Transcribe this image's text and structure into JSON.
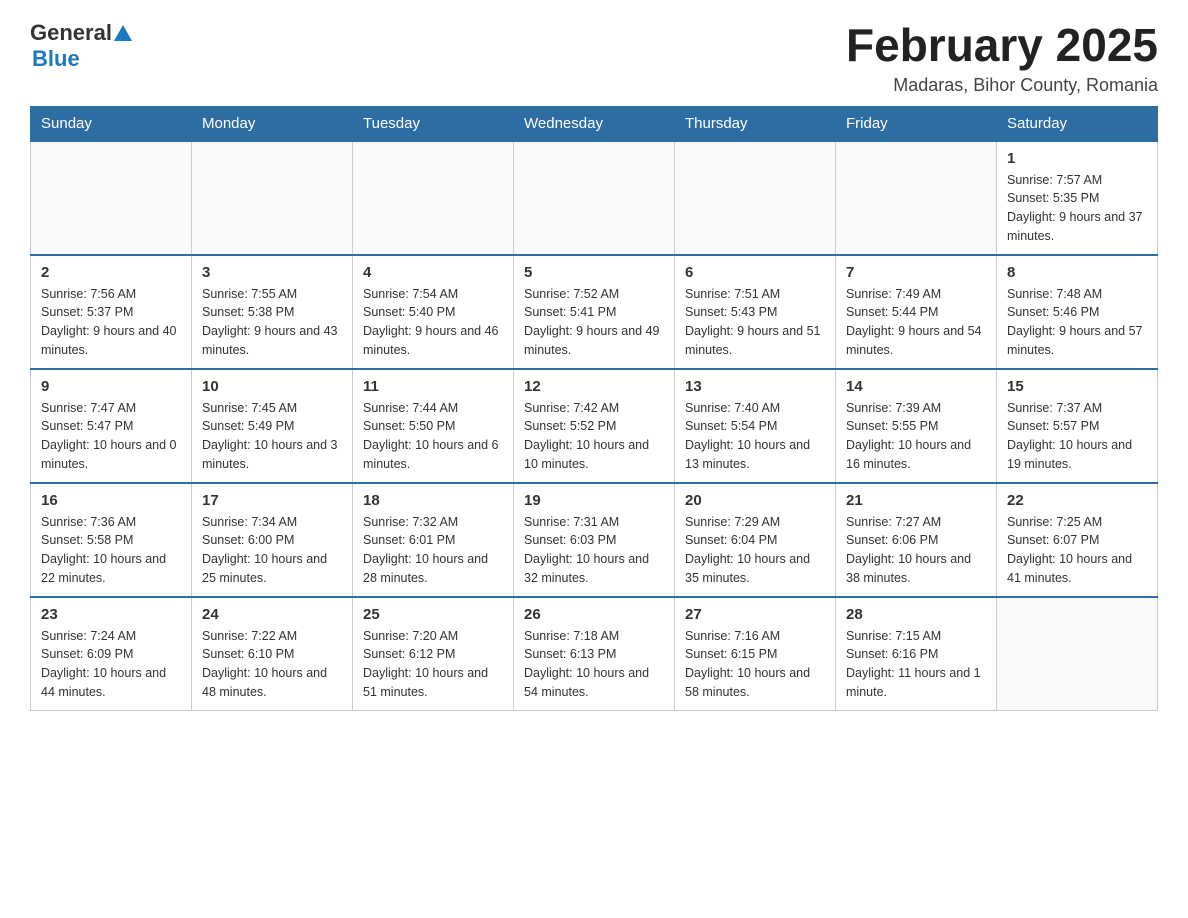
{
  "header": {
    "logo_general": "General",
    "logo_blue": "Blue",
    "title": "February 2025",
    "location": "Madaras, Bihor County, Romania"
  },
  "days_of_week": [
    "Sunday",
    "Monday",
    "Tuesday",
    "Wednesday",
    "Thursday",
    "Friday",
    "Saturday"
  ],
  "weeks": [
    [
      {
        "day": "",
        "info": ""
      },
      {
        "day": "",
        "info": ""
      },
      {
        "day": "",
        "info": ""
      },
      {
        "day": "",
        "info": ""
      },
      {
        "day": "",
        "info": ""
      },
      {
        "day": "",
        "info": ""
      },
      {
        "day": "1",
        "info": "Sunrise: 7:57 AM\nSunset: 5:35 PM\nDaylight: 9 hours and 37 minutes."
      }
    ],
    [
      {
        "day": "2",
        "info": "Sunrise: 7:56 AM\nSunset: 5:37 PM\nDaylight: 9 hours and 40 minutes."
      },
      {
        "day": "3",
        "info": "Sunrise: 7:55 AM\nSunset: 5:38 PM\nDaylight: 9 hours and 43 minutes."
      },
      {
        "day": "4",
        "info": "Sunrise: 7:54 AM\nSunset: 5:40 PM\nDaylight: 9 hours and 46 minutes."
      },
      {
        "day": "5",
        "info": "Sunrise: 7:52 AM\nSunset: 5:41 PM\nDaylight: 9 hours and 49 minutes."
      },
      {
        "day": "6",
        "info": "Sunrise: 7:51 AM\nSunset: 5:43 PM\nDaylight: 9 hours and 51 minutes."
      },
      {
        "day": "7",
        "info": "Sunrise: 7:49 AM\nSunset: 5:44 PM\nDaylight: 9 hours and 54 minutes."
      },
      {
        "day": "8",
        "info": "Sunrise: 7:48 AM\nSunset: 5:46 PM\nDaylight: 9 hours and 57 minutes."
      }
    ],
    [
      {
        "day": "9",
        "info": "Sunrise: 7:47 AM\nSunset: 5:47 PM\nDaylight: 10 hours and 0 minutes."
      },
      {
        "day": "10",
        "info": "Sunrise: 7:45 AM\nSunset: 5:49 PM\nDaylight: 10 hours and 3 minutes."
      },
      {
        "day": "11",
        "info": "Sunrise: 7:44 AM\nSunset: 5:50 PM\nDaylight: 10 hours and 6 minutes."
      },
      {
        "day": "12",
        "info": "Sunrise: 7:42 AM\nSunset: 5:52 PM\nDaylight: 10 hours and 10 minutes."
      },
      {
        "day": "13",
        "info": "Sunrise: 7:40 AM\nSunset: 5:54 PM\nDaylight: 10 hours and 13 minutes."
      },
      {
        "day": "14",
        "info": "Sunrise: 7:39 AM\nSunset: 5:55 PM\nDaylight: 10 hours and 16 minutes."
      },
      {
        "day": "15",
        "info": "Sunrise: 7:37 AM\nSunset: 5:57 PM\nDaylight: 10 hours and 19 minutes."
      }
    ],
    [
      {
        "day": "16",
        "info": "Sunrise: 7:36 AM\nSunset: 5:58 PM\nDaylight: 10 hours and 22 minutes."
      },
      {
        "day": "17",
        "info": "Sunrise: 7:34 AM\nSunset: 6:00 PM\nDaylight: 10 hours and 25 minutes."
      },
      {
        "day": "18",
        "info": "Sunrise: 7:32 AM\nSunset: 6:01 PM\nDaylight: 10 hours and 28 minutes."
      },
      {
        "day": "19",
        "info": "Sunrise: 7:31 AM\nSunset: 6:03 PM\nDaylight: 10 hours and 32 minutes."
      },
      {
        "day": "20",
        "info": "Sunrise: 7:29 AM\nSunset: 6:04 PM\nDaylight: 10 hours and 35 minutes."
      },
      {
        "day": "21",
        "info": "Sunrise: 7:27 AM\nSunset: 6:06 PM\nDaylight: 10 hours and 38 minutes."
      },
      {
        "day": "22",
        "info": "Sunrise: 7:25 AM\nSunset: 6:07 PM\nDaylight: 10 hours and 41 minutes."
      }
    ],
    [
      {
        "day": "23",
        "info": "Sunrise: 7:24 AM\nSunset: 6:09 PM\nDaylight: 10 hours and 44 minutes."
      },
      {
        "day": "24",
        "info": "Sunrise: 7:22 AM\nSunset: 6:10 PM\nDaylight: 10 hours and 48 minutes."
      },
      {
        "day": "25",
        "info": "Sunrise: 7:20 AM\nSunset: 6:12 PM\nDaylight: 10 hours and 51 minutes."
      },
      {
        "day": "26",
        "info": "Sunrise: 7:18 AM\nSunset: 6:13 PM\nDaylight: 10 hours and 54 minutes."
      },
      {
        "day": "27",
        "info": "Sunrise: 7:16 AM\nSunset: 6:15 PM\nDaylight: 10 hours and 58 minutes."
      },
      {
        "day": "28",
        "info": "Sunrise: 7:15 AM\nSunset: 6:16 PM\nDaylight: 11 hours and 1 minute."
      },
      {
        "day": "",
        "info": ""
      }
    ]
  ]
}
